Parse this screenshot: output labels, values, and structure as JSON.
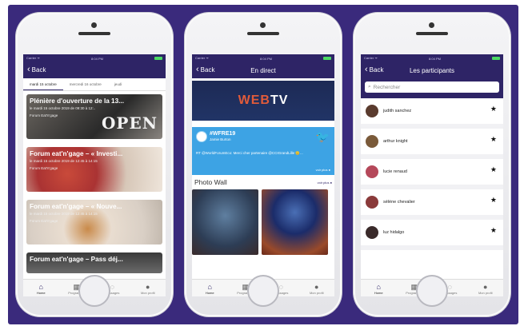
{
  "status": {
    "carrier": "Carrier ᯤ",
    "time": "8:04 PM"
  },
  "screen1": {
    "back_label": "Back",
    "days": [
      "mardi 15 octobre",
      "mercredi 16 octobre",
      "jeudi"
    ],
    "sessions": [
      {
        "title": "Plénière d'ouverture de la 13...",
        "date": "le mardi 15 octobre 2019 de 09:30 à 12:..",
        "location": "Forum Eat'n'gage",
        "overlay": "OPEN"
      },
      {
        "title": "Forum eat'n'gage – « Investi...",
        "date": "le mardi 15 octobre 2019 de 12:45 à 14:15",
        "location": "Forum Eat'n'gage"
      },
      {
        "title": "Forum eat'n'gage – « Nouve...",
        "date": "le mardi 15 octobre 2019 de 12:45 à 14:15",
        "location": "Forum Eat'n'gage"
      },
      {
        "title": "Forum eat'n'gage – Pass déj...",
        "date": "",
        "location": ""
      }
    ]
  },
  "screen2": {
    "back_label": "Back",
    "title": "En direct",
    "webtv_w": "WEB",
    "webtv_rest": " TV",
    "tweet": {
      "tag": "#WFRE19",
      "author": "Jamie Burton",
      "text": "RT @WorldForumEco: Merci cher partenaire @CCIGrandLille 😊...",
      "more": "voir plus ●"
    },
    "photowall_title": "Photo Wall",
    "photowall_more": "voir plus ●"
  },
  "screen3": {
    "back_label": "Back",
    "title": "Les participants",
    "search_placeholder": "Rechercher",
    "participants": [
      {
        "name": "judith sanchez",
        "avatar_color": "#5a3b2e"
      },
      {
        "name": "arthur knight",
        "avatar_color": "#7a5a3a"
      },
      {
        "name": "lucie renaud",
        "avatar_color": "#b5485a"
      },
      {
        "name": "séléne chevalier",
        "avatar_color": "#8a3a3a"
      },
      {
        "name": "luz hidalgo",
        "avatar_color": "#3a2a2a"
      }
    ]
  },
  "tabbar": {
    "items": [
      {
        "label": "Home",
        "icon": "home-icon"
      },
      {
        "label": "Programme",
        "icon": "calendar-icon"
      },
      {
        "label": "Messages",
        "icon": "chat-icon"
      },
      {
        "label": "Mon profil",
        "icon": "profile-icon"
      }
    ]
  }
}
